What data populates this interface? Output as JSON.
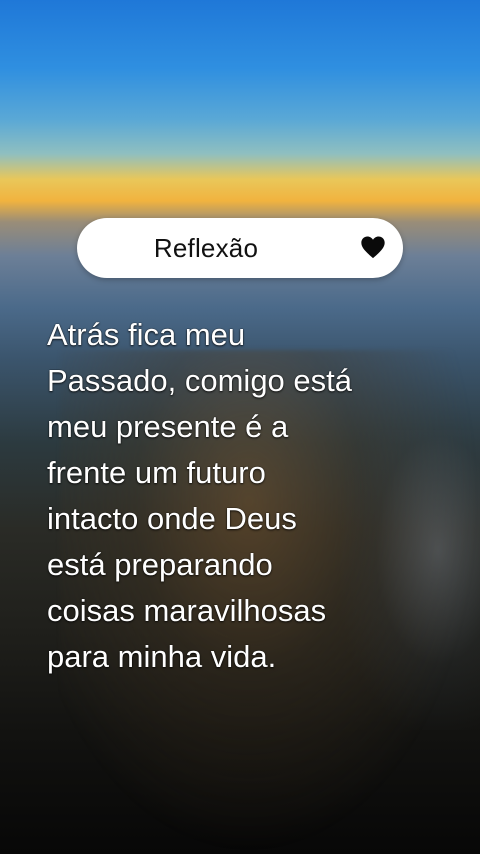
{
  "card": {
    "title": "Reflexão",
    "icon": "heart-icon"
  },
  "quote": {
    "lines": [
      "Atrás fica meu",
      "Passado, comigo está",
      "meu presente é a",
      "frente um futuro",
      "intacto onde Deus",
      "está preparando",
      "coisas maravilhosas",
      "para minha vida."
    ]
  }
}
